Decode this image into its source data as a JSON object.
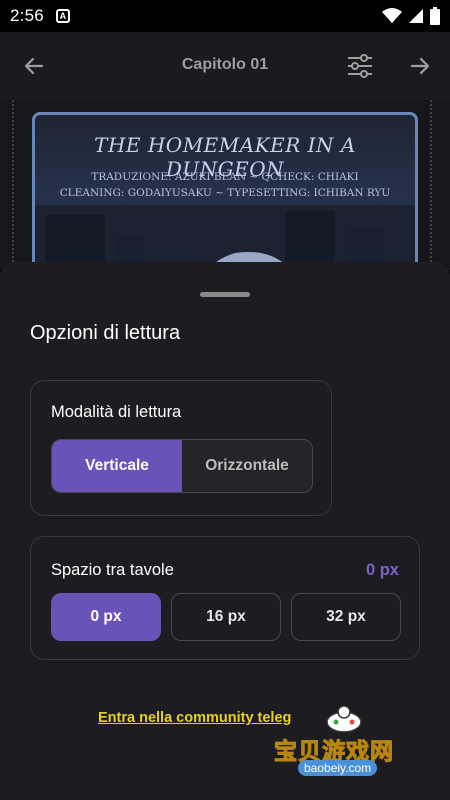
{
  "status_bar": {
    "time": "2:56",
    "notification_icon": "a-box-icon",
    "right_icons": [
      "wifi-icon",
      "signal-icon",
      "battery-icon"
    ]
  },
  "app_bar": {
    "chapter_title": "Capitolo 01",
    "back_icon": "arrow-left-icon",
    "settings_icon": "sliders-icon",
    "next_icon": "arrow-right-icon"
  },
  "comic": {
    "title": "THE HOMEMAKER IN A DUNGEON",
    "credit_line_1": "TRADUZIONE: AZUKI BEAN ~ QCHECK: CHIAKI",
    "credit_line_2": "CLEANING: GODAIYUSAKU ~ TYPESETTING: ICHIBAN RYU"
  },
  "sheet": {
    "title": "Opzioni di lettura",
    "reading_mode": {
      "label": "Modalità di lettura",
      "options": [
        "Verticale",
        "Orizzontale"
      ],
      "selected": "Verticale"
    },
    "page_spacing": {
      "label": "Spazio tra tavole",
      "value": "0 px",
      "options": [
        "0 px",
        "16 px",
        "32 px"
      ],
      "selected": "0 px"
    },
    "community_link": "Entra nella community teleg"
  },
  "watermark": {
    "text": "宝贝游戏网",
    "url": "baobeiy.com"
  },
  "colors": {
    "accent": "#6a53b8",
    "link": "#e6d21a",
    "sheet_bg": "#1d1c20",
    "app_bar_bg": "#1b1a1e"
  }
}
